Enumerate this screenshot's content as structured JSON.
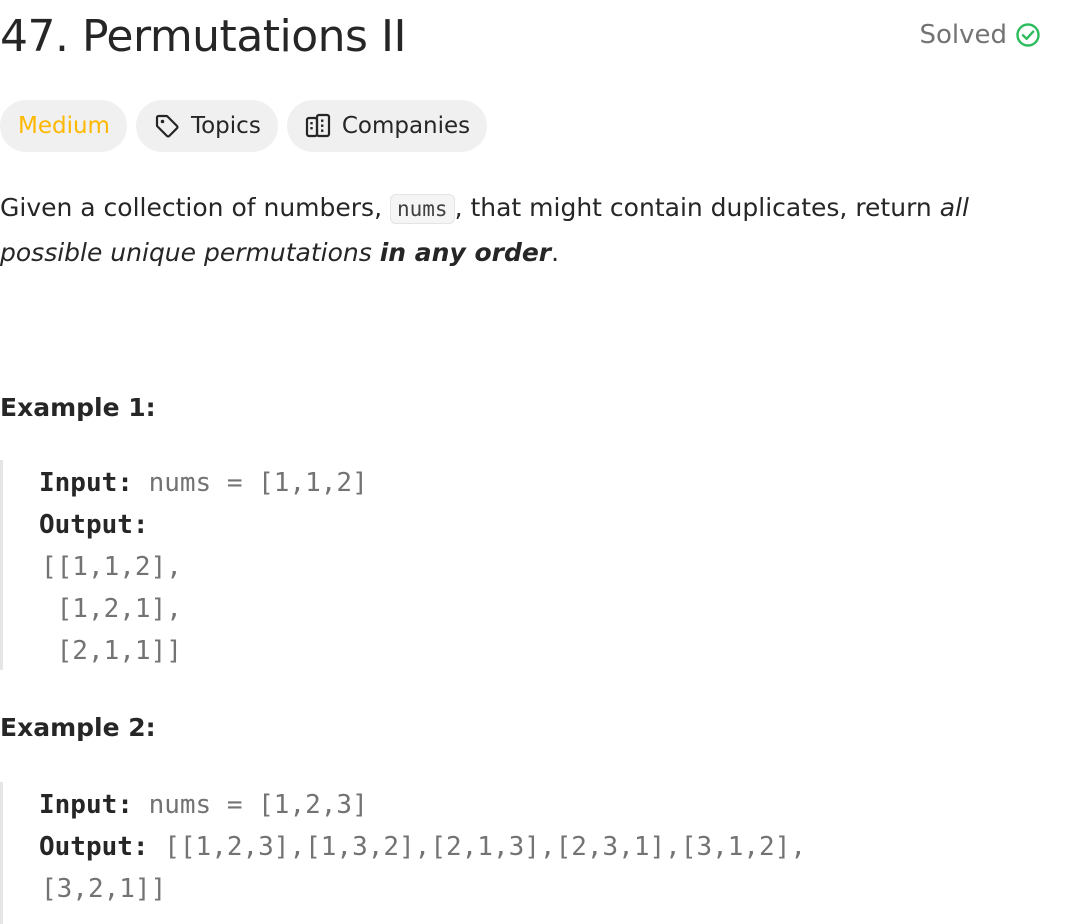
{
  "problem": {
    "title": "47. Permutations II",
    "status": "Solved"
  },
  "tags": {
    "difficulty": "Medium",
    "topics": "Topics",
    "companies": "Companies"
  },
  "description": {
    "part1": "Given a collection of numbers, ",
    "code": "nums",
    "part2": ", that might contain duplicates, return ",
    "italic": "all possible unique permutations",
    "space": " ",
    "bold_italic": "in any order",
    "end": "."
  },
  "examples": [
    {
      "title": "Example 1:",
      "input_label": "Input:",
      "input_value": " nums = [1,1,2]",
      "output_label": "Output:",
      "output_lines": [
        "[[1,1,2],",
        " [1,2,1],",
        " [2,1,1]]"
      ]
    },
    {
      "title": "Example 2:",
      "input_label": "Input:",
      "input_value": " nums = [1,2,3]",
      "output_label": "Output:",
      "output_value": " [[1,2,3],[1,3,2],[2,1,3],[2,3,1],[3,1,2],",
      "output_continuation": "[3,2,1]]"
    }
  ],
  "colors": {
    "difficulty_medium": "#ffb800",
    "solved_check": "#2cbb5d",
    "text_primary": "#262626",
    "text_secondary": "#737373",
    "tag_background": "#f0f0f0"
  },
  "icons": {
    "solved": "check-circle-icon",
    "topics": "tag-icon",
    "companies": "building-icon"
  }
}
